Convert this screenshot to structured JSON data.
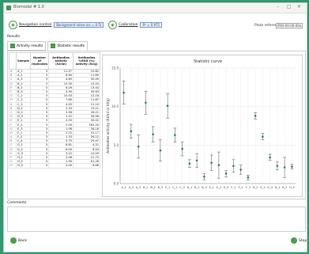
{
  "window": {
    "title": "Biomodel # 1.0",
    "controls": [
      "–",
      "□",
      "✕"
    ]
  },
  "toolbar": {
    "navigation_label": "Navigation control",
    "navigation_pill": "Background noise (xx = 0.5)",
    "calibration_label": "Calibration",
    "calibration_pill": "R² = 0.971",
    "plate_ref_label": "Plate reference",
    "plate_ref_value": "PRD-00-00-00x"
  },
  "results_label": "Results",
  "tabs": [
    {
      "label": "Activity results"
    },
    {
      "label": "Statistic results"
    }
  ],
  "table": {
    "headers": [
      "",
      "Sample",
      "Number of replicates",
      "Antibodies activity (IU/ml)",
      "Antibodies %RSD (%) activity (IU/g)"
    ],
    "rows": [
      [
        "A",
        "A_1",
        "3",
        "11.57",
        "10.82"
      ],
      [
        "B",
        "A_2",
        "3",
        "8.84",
        "11.69"
      ],
      [
        "C",
        "A_3",
        "3",
        "4.85",
        "30.09"
      ],
      [
        "D",
        "B_1",
        "3",
        "10.30",
        "10.20"
      ],
      [
        "E",
        "B_2",
        "3",
        "8.26",
        "13.43"
      ],
      [
        "F",
        "B_3",
        "3",
        "3.90",
        "35.63"
      ],
      [
        "G",
        "C_1",
        "3",
        "10.03",
        "12.16"
      ],
      [
        "H",
        "C_2",
        "3",
        "7.60",
        "11.67"
      ],
      [
        "A",
        "C_3",
        "3",
        "4.05",
        "21.10"
      ],
      [
        "B",
        "D_1",
        "3",
        "2.33",
        "15.21"
      ],
      [
        "C",
        "D_2",
        "3",
        "2.56",
        "26.21"
      ],
      [
        "D",
        "D_3",
        "3",
        "1.02",
        "28.96"
      ],
      [
        "E",
        "E_1",
        "3",
        "2.50",
        "30.02"
      ],
      [
        "F",
        "E_2",
        "3",
        "2.00",
        "162.20"
      ],
      [
        "G",
        "E_3",
        "3",
        "1.08",
        "28.18"
      ],
      [
        "H",
        "F_1",
        "3",
        "2.22",
        "31.17"
      ],
      [
        "A",
        "F_2",
        "3",
        "1.33",
        "26.12"
      ],
      [
        "B",
        "C_4",
        "3",
        "0.75",
        "29.47"
      ],
      [
        "C",
        "G_1",
        "3",
        "8.81",
        "4.21"
      ],
      [
        "D",
        "G_2",
        "3",
        "6.00",
        "6.04"
      ],
      [
        "E",
        "G_3",
        "3",
        "3.22",
        "10.09"
      ],
      [
        "F",
        "H_1",
        "3",
        "2.06",
        "21.72"
      ],
      [
        "G",
        "H_2",
        "3",
        "1.90",
        "61.28"
      ],
      [
        "H",
        "H_3",
        "3",
        "2.00",
        "6.66"
      ]
    ]
  },
  "comments_label": "Comments",
  "footer": {
    "back_label": "Back",
    "stop_label": "Stop"
  },
  "colors": {
    "accent": "#2e9a6e",
    "point": "#2a8a4a"
  },
  "chart_data": {
    "type": "scatter",
    "title": "Statistic curve",
    "ylabel": "Antibodies activity (IU/ml or IU/g)",
    "xlabel": "",
    "ylim": [
      0,
      15
    ],
    "yticks": [
      0.0,
      5.0,
      10.0,
      15.0
    ],
    "grid": true,
    "categories": [
      "A_1",
      "A_2",
      "A_3",
      "B_1",
      "B_2",
      "B_3",
      "C_1",
      "C_2",
      "C_3",
      "D_1",
      "D_2",
      "D_3",
      "E_1",
      "E_2",
      "E_3",
      "F_1",
      "F_2",
      "F_3",
      "G_1",
      "G_2",
      "G_3",
      "H_1",
      "H_2",
      "H_3"
    ],
    "values": [
      11.8,
      6.8,
      4.8,
      10.5,
      6.4,
      4.3,
      10.1,
      6.3,
      4.5,
      2.6,
      3.0,
      0.9,
      2.7,
      2.4,
      1.3,
      2.3,
      1.8,
      0.8,
      8.8,
      6.1,
      3.4,
      2.3,
      2.1,
      2.2
    ],
    "errors": [
      1.5,
      0.9,
      1.5,
      1.5,
      1.0,
      1.4,
      1.6,
      0.9,
      0.9,
      0.5,
      0.9,
      0.4,
      1.0,
      1.7,
      0.4,
      0.8,
      0.6,
      0.3,
      0.4,
      0.4,
      0.4,
      0.5,
      1.3,
      0.3
    ]
  }
}
